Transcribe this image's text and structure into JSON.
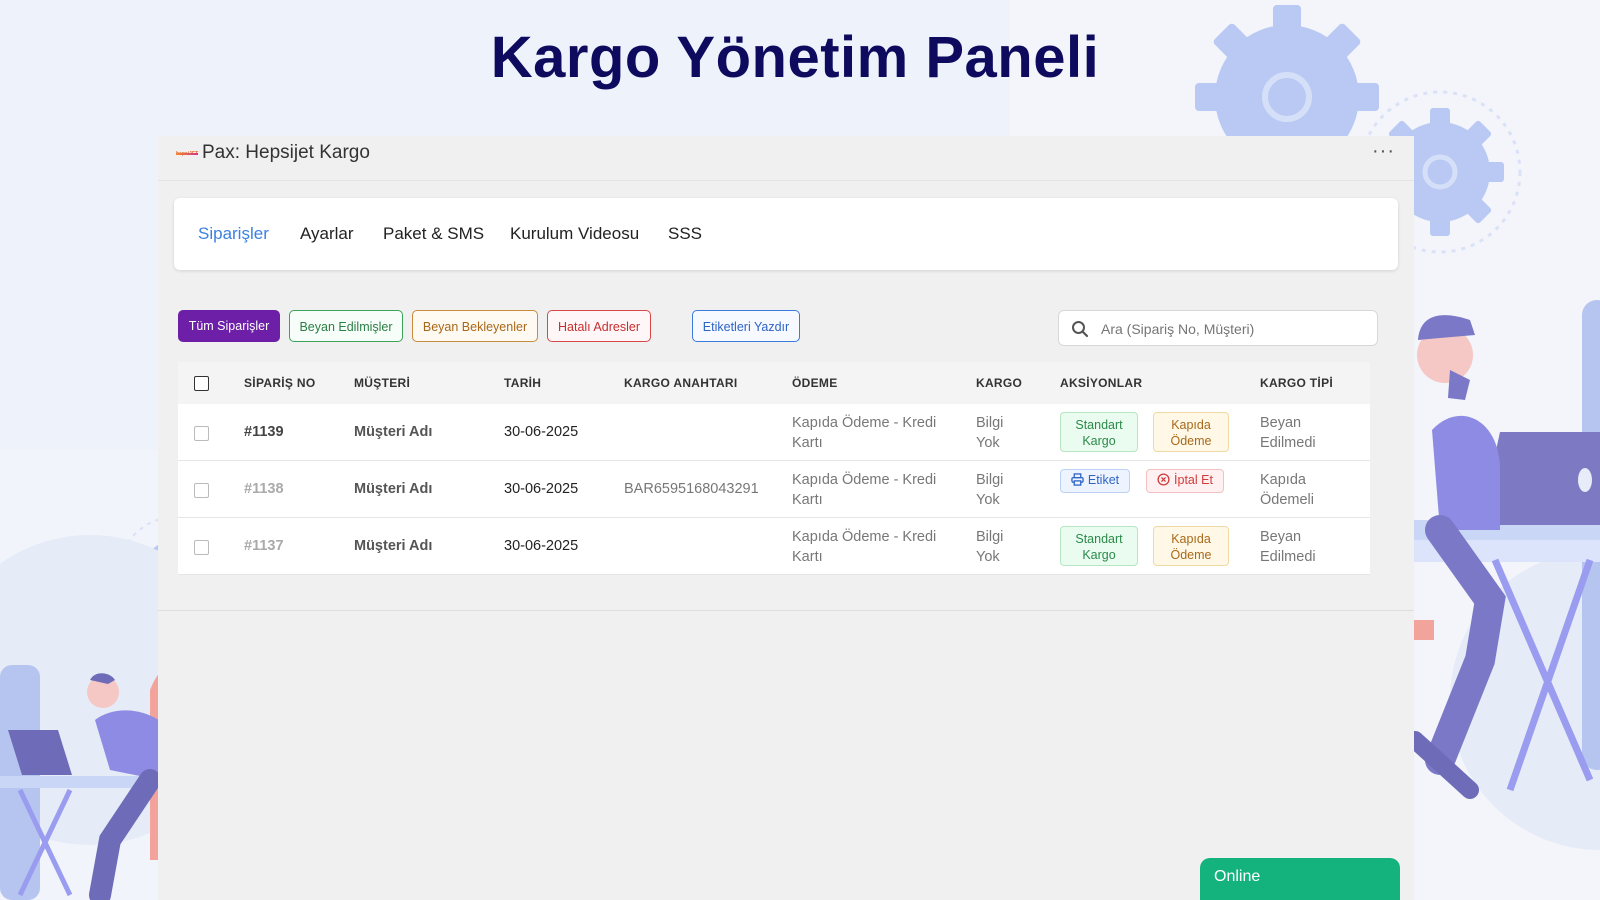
{
  "page_title": "Kargo Yönetim Paneli",
  "window": {
    "title": "Pax: Hepsijet Kargo",
    "logo_text": "hepsiJET",
    "more_label": "···"
  },
  "tabs": [
    {
      "label": "Siparişler",
      "active": true
    },
    {
      "label": "Ayarlar"
    },
    {
      "label": "Paket & SMS"
    },
    {
      "label": "Kurulum Videosu"
    },
    {
      "label": "SSS"
    }
  ],
  "filters": {
    "all": "Tüm Siparişler",
    "declared": "Beyan Edilmişler",
    "pending": "Beyan Bekleyenler",
    "wrong_address": "Hatalı Adresler",
    "print_labels": "Etiketleri Yazdır"
  },
  "search": {
    "placeholder": "Ara (Sipariş No, Müşteri)"
  },
  "table": {
    "headers": [
      "SİPARİŞ NO",
      "MÜŞTERİ",
      "TARİH",
      "KARGO ANAHTARI",
      "ÖDEME",
      "KARGO",
      "AKSİYONLAR",
      "KARGO TİPİ"
    ],
    "rows": [
      {
        "no": "#1139",
        "customer": "Müşteri Adı",
        "date": "30-06-2025",
        "key": "",
        "payment": "Kapıda Ödeme - Kredi Kartı",
        "cargo": "Bilgi Yok",
        "action1": "Standart Kargo",
        "action2": "Kapıda Ödeme",
        "type": "Beyan Edilmedi"
      },
      {
        "no": "#1138",
        "customer": "Müşteri Adı",
        "date": "30-06-2025",
        "key": "BAR6595168043291",
        "payment": "Kapıda Ödeme - Kredi Kartı",
        "cargo": "Bilgi Yok",
        "action1": "Etiket",
        "action2": "İptal Et",
        "type": "Kapıda Ödemeli"
      },
      {
        "no": "#1137",
        "customer": "Müşteri Adı",
        "date": "30-06-2025",
        "key": "",
        "payment": "Kapıda Ödeme - Kredi Kartı",
        "cargo": "Bilgi Yok",
        "action1": "Standart Kargo",
        "action2": "Kapıda Ödeme",
        "type": "Beyan Edilmedi"
      }
    ]
  },
  "online_label": "Online",
  "colors": {
    "accent": "#6e1fa8",
    "title": "#0e0b5e",
    "tab_active": "#3b82e0",
    "online": "#14b37d"
  }
}
